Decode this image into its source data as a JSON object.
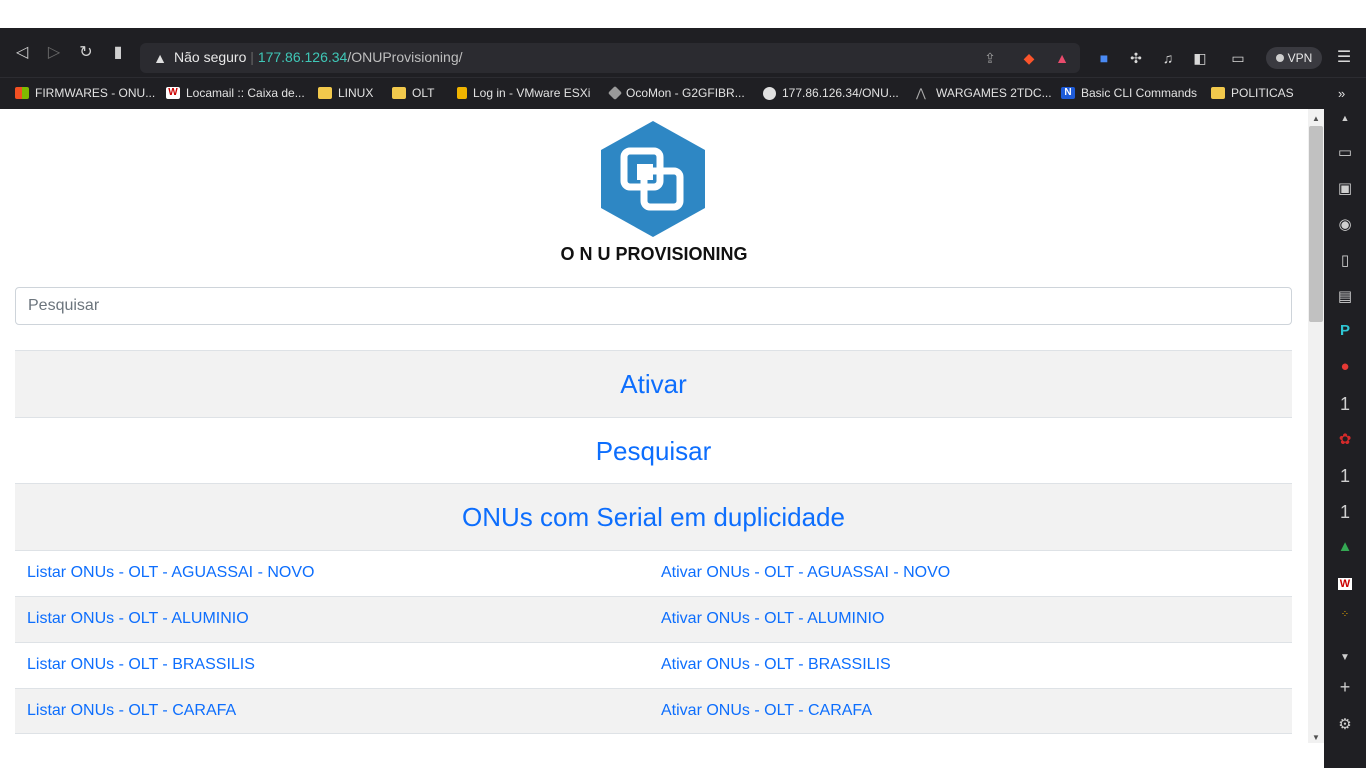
{
  "browser": {
    "security_label": "Não seguro",
    "url_host": "177.86.126.34",
    "url_path": "/ONUProvisioning/",
    "vpn_label": "VPN",
    "bookmarks": [
      {
        "label": "FIRMWARES - ONU...",
        "icon": "windows-icon"
      },
      {
        "label": "Locamail :: Caixa de...",
        "icon": "w-logo-icon"
      },
      {
        "label": "LINUX",
        "icon": "folder-icon"
      },
      {
        "label": "OLT",
        "icon": "folder-icon"
      },
      {
        "label": "Log in - VMware ESXi",
        "icon": "vmware-icon"
      },
      {
        "label": "OcoMon - G2GFIBR...",
        "icon": "ocomon-icon"
      },
      {
        "label": "177.86.126.34/ONU...",
        "icon": "globe-icon"
      },
      {
        "label": "WARGAMES 2TDC...",
        "icon": "wargames-icon"
      },
      {
        "label": "Basic CLI Commands",
        "icon": "n-logo-icon"
      },
      {
        "label": "POLITICAS",
        "icon": "folder-icon"
      }
    ],
    "sidebar_numbers": [
      "1",
      "1",
      "1"
    ]
  },
  "page": {
    "title": "O N U PROVISIONING",
    "search_placeholder": "Pesquisar",
    "menu": [
      {
        "label": "Ativar"
      },
      {
        "label": "Pesquisar"
      },
      {
        "label": "ONUs com Serial em duplicidade"
      }
    ],
    "olts": [
      {
        "list": "Listar ONUs - OLT - AGUASSAI - NOVO",
        "activate": "Ativar ONUs - OLT - AGUASSAI - NOVO"
      },
      {
        "list": "Listar ONUs - OLT - ALUMINIO",
        "activate": "Ativar ONUs - OLT - ALUMINIO"
      },
      {
        "list": "Listar ONUs - OLT - BRASSILIS",
        "activate": "Ativar ONUs - OLT - BRASSILIS"
      },
      {
        "list": "Listar ONUs - OLT - CARAFA",
        "activate": "Ativar ONUs - OLT - CARAFA"
      }
    ]
  },
  "colors": {
    "link": "#0d6efd",
    "logo": "#2e87c4",
    "chrome_bg": "#1f1f23",
    "url_host": "#3fc7b7"
  }
}
